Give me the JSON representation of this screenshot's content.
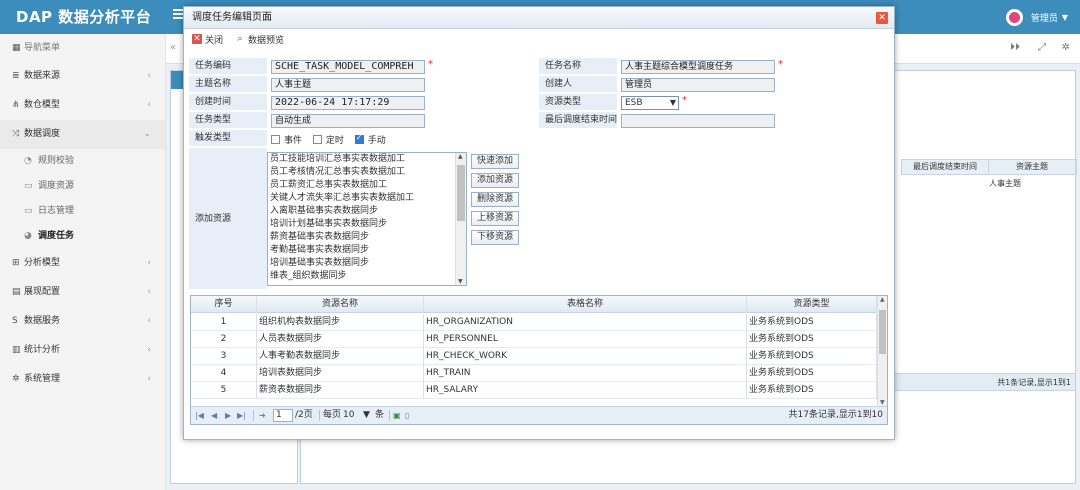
{
  "app": {
    "title": "DAP 数据分析平台",
    "user": "管理员"
  },
  "sidebar": {
    "header": "导航菜单",
    "items": [
      {
        "label": "数据来源",
        "icon": "database-icon"
      },
      {
        "label": "数仓模型",
        "icon": "share-icon"
      },
      {
        "label": "数据调度",
        "icon": "shuffle-icon"
      },
      {
        "label": "分析模型",
        "icon": "chart-icon"
      },
      {
        "label": "展现配置",
        "icon": "layout-icon"
      },
      {
        "label": "数据服务",
        "icon": "dollar-icon"
      },
      {
        "label": "统计分析",
        "icon": "bar-chart-icon"
      },
      {
        "label": "系统管理",
        "icon": "gear-icon"
      }
    ],
    "subitems": [
      "规则校验",
      "调度资源",
      "日志管理",
      "调度任务"
    ]
  },
  "background": {
    "grid_headers": [
      "最后调度结束时间",
      "资源主题"
    ],
    "grid_cell": "人事主题",
    "pager_text": "共1条记录,显示1到1"
  },
  "modal": {
    "title": "调度任务编辑页面",
    "toolbar": {
      "close": "关闭",
      "preview": "数据预览"
    },
    "labels": {
      "task_code": "任务编码",
      "task_name": "任务名称",
      "theme": "主题名称",
      "creator": "创建人",
      "create_time": "创建时间",
      "resource_type": "资源类型",
      "task_type": "任务类型",
      "last_end": "最后调度结束时间",
      "trigger": "触发类型",
      "add_resource": "添加资源"
    },
    "values": {
      "task_code": "SCHE_TASK_MODEL_COMPREH",
      "task_name": "人事主题综合模型调度任务",
      "theme": "人事主题",
      "creator": "管理员",
      "create_time": "2022-06-24 17:17:29",
      "resource_type": "ESB",
      "task_type": "自动生成",
      "last_end": ""
    },
    "triggers": [
      {
        "label": "事件",
        "checked": false
      },
      {
        "label": "定时",
        "checked": false
      },
      {
        "label": "手动",
        "checked": true
      }
    ],
    "resource_list": [
      "员工技能培训汇总事实表数据加工",
      "员工考核情况汇总事实表数据加工",
      "员工薪资汇总事实表数据加工",
      "关键人才流失率汇总事实表数据加工",
      "入离职基础事实表数据同步",
      "培训计划基础事实表数据同步",
      "薪资基础事实表数据同步",
      "考勤基础事实表数据同步",
      "培训基础事实表数据同步",
      "维表_组织数据同步"
    ],
    "resource_buttons": [
      "快速添加",
      "添加资源",
      "删除资源",
      "上移资源",
      "下移资源"
    ],
    "grid": {
      "headers": [
        "序号",
        "资源名称",
        "表格名称",
        "资源类型"
      ],
      "rows": [
        [
          "1",
          "组织机构表数据同步",
          "HR_ORGANIZATION",
          "业务系统到ODS"
        ],
        [
          "2",
          "人员表数据同步",
          "HR_PERSONNEL",
          "业务系统到ODS"
        ],
        [
          "3",
          "人事考勤表数据同步",
          "HR_CHECK_WORK",
          "业务系统到ODS"
        ],
        [
          "4",
          "培训表数据同步",
          "HR_TRAIN",
          "业务系统到ODS"
        ],
        [
          "5",
          "薪资表数据同步",
          "HR_SALARY",
          "业务系统到ODS"
        ]
      ]
    },
    "pager": {
      "page": "1",
      "of_pages": "/2页",
      "per_page_prefix": "每页",
      "per_page": "10",
      "per_page_suffix": "条",
      "summary": "共17条记录,显示1到10"
    }
  },
  "colors": {
    "topbar": "#3c8dbc",
    "label_bg": "#e7eef7",
    "required": "#e22233"
  }
}
